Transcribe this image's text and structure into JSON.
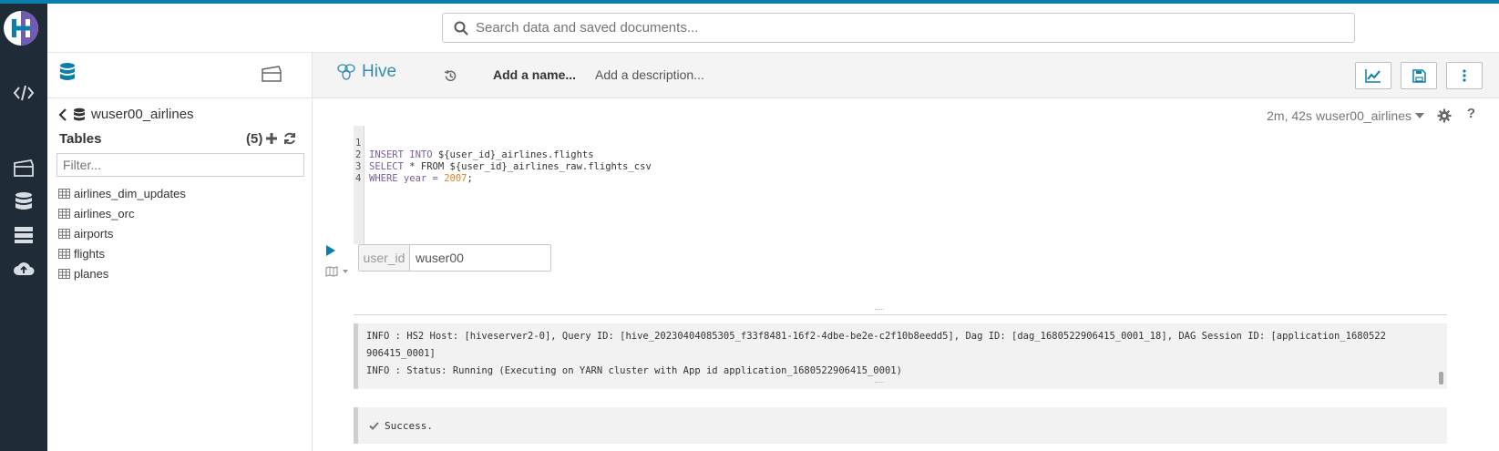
{
  "header": {
    "search_placeholder": "Search data and saved documents..."
  },
  "left_panel": {
    "database": "wuser00_airlines",
    "tables_title": "Tables",
    "tables_count": "(5)",
    "filter_placeholder": "Filter...",
    "tables": [
      "airlines_dim_updates",
      "airlines_orc",
      "airports",
      "flights",
      "planes"
    ]
  },
  "editor_header": {
    "app_name": "Hive",
    "add_name": "Add a name...",
    "add_description": "Add a description..."
  },
  "status": {
    "elapsed": "2m, 42s",
    "database": "wuser00_airlines"
  },
  "editor": {
    "lines": [
      {
        "num": "1",
        "kw1": "INSERT INTO",
        "text": " ${user_id}_airlines.flights"
      },
      {
        "num": "2",
        "kw1": "SELECT",
        "text": " * FROM ${user_id}_airlines_raw.flights_csv"
      },
      {
        "num": "3",
        "kw1": "WHERE",
        "text": " year = ",
        "num_val": "2007",
        "tail": ";"
      },
      {
        "num": "4",
        "kw1": "",
        "text": ""
      }
    ]
  },
  "parameters": {
    "label": "user_id",
    "value": "wuser00"
  },
  "log": {
    "line1": "INFO  : HS2 Host: [hiveserver2-0], Query ID: [hive_20230404085305_f33f8481-16f2-4dbe-be2e-c2f10b8eedd5], Dag ID: [dag_1680522906415_0001_18], DAG Session ID: [application_1680522",
    "line2": "906415_0001]",
    "line3": "INFO  : Status: Running (Executing on YARN cluster with App id application_1680522906415_0001)"
  },
  "result": {
    "message": "Success."
  },
  "colors": {
    "accent": "#0b7fab",
    "nav_bg": "#1f2b36",
    "hive_blue": "#338bb8"
  }
}
